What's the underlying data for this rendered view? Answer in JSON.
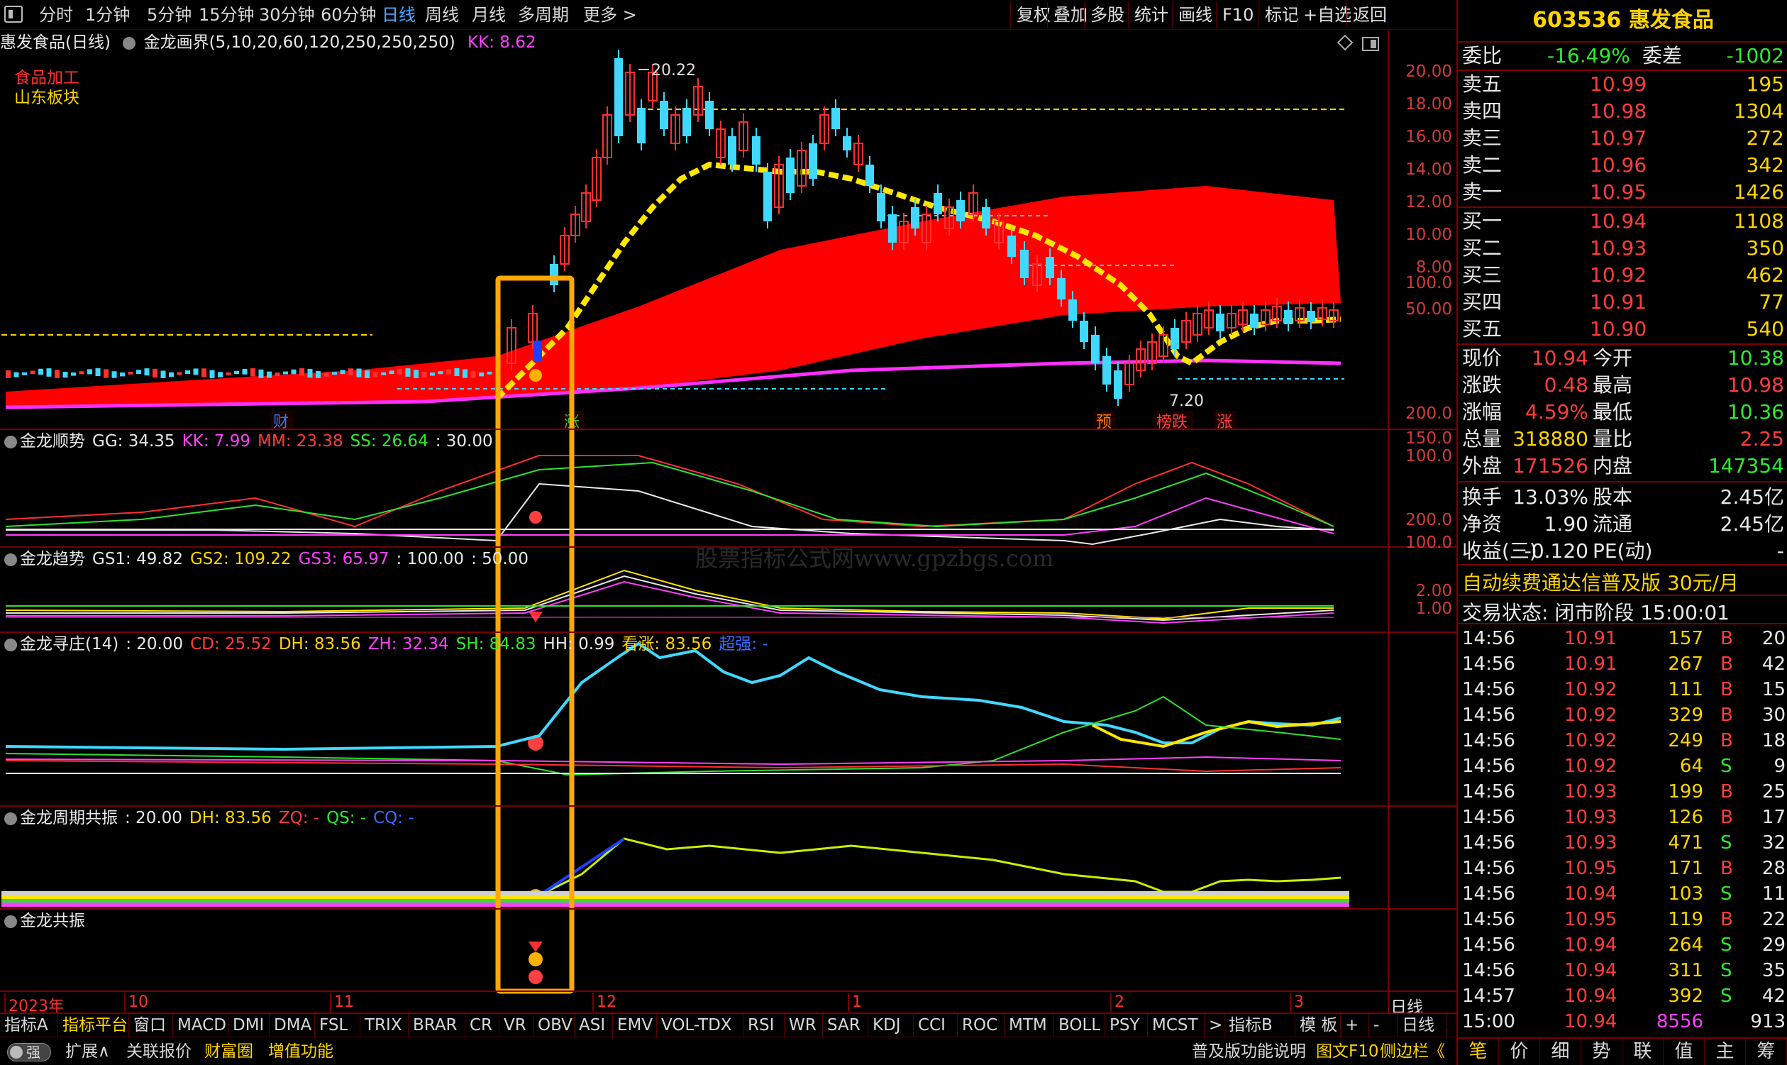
{
  "toolbar": {
    "items": [
      "分时",
      "1分钟",
      "5分钟",
      "15分钟",
      "30分钟",
      "60分钟",
      "日线",
      "周线",
      "月线",
      "多周期",
      "更多 >"
    ],
    "active_index": 6,
    "right_items": [
      "复权",
      "叠加",
      "多股",
      "统计",
      "画线",
      "F10",
      "标记",
      "+自选",
      "返回"
    ]
  },
  "chart_header": {
    "stock": "惠发食品(日线)",
    "indicator": "金龙画界(5,10,20,60,120,250,250,250)",
    "kk": "KK: 8.62",
    "tag1": "食品加工",
    "tag2": "山东板块"
  },
  "price_axis": [
    "20.00",
    "18.00",
    "16.00",
    "14.00",
    "12.00",
    "10.00",
    "8.00"
  ],
  "annotations": {
    "high": "20.22",
    "low": "7.20",
    "markers": [
      "财",
      "涨",
      "预",
      "榜跌",
      "涨"
    ]
  },
  "panels": [
    {
      "name": "金龙顺势",
      "values": [
        {
          "t": "GG: 34.35",
          "c": "white"
        },
        {
          "t": "KK: 7.99",
          "c": "magenta"
        },
        {
          "t": "MM: 23.38",
          "c": "red"
        },
        {
          "t": "SS: 26.64",
          "c": "green"
        },
        {
          "t": ": 30.00",
          "c": "white"
        }
      ],
      "axis": [
        "100.0",
        "50.00"
      ]
    },
    {
      "name": "金龙趋势",
      "values": [
        {
          "t": "GS1: 49.82",
          "c": "white"
        },
        {
          "t": "GS2: 109.22",
          "c": "yellow"
        },
        {
          "t": "GS3: 65.97",
          "c": "magenta"
        },
        {
          "t": ": 100.00",
          "c": "white"
        },
        {
          "t": ": 50.00",
          "c": "white"
        }
      ],
      "axis": []
    },
    {
      "name": "金龙寻庄(14)",
      "values": [
        {
          "t": ": 20.00",
          "c": "white"
        },
        {
          "t": "CD: 25.52",
          "c": "red"
        },
        {
          "t": "DH: 83.56",
          "c": "yellow"
        },
        {
          "t": "ZH: 32.34",
          "c": "magenta"
        },
        {
          "t": "SH: 84.83",
          "c": "green"
        },
        {
          "t": "HH: 0.99",
          "c": "white"
        },
        {
          "t": "看涨: 83.56",
          "c": "yellow"
        },
        {
          "t": "超强: -",
          "c": "blue"
        }
      ],
      "axis": [
        "200.0",
        "150.0",
        "100.0"
      ]
    },
    {
      "name": "金龙周期共振",
      "values": [
        {
          "t": ": 20.00",
          "c": "white"
        },
        {
          "t": "DH: 83.56",
          "c": "yellow"
        },
        {
          "t": "ZQ: -",
          "c": "red"
        },
        {
          "t": "QS: -",
          "c": "green"
        },
        {
          "t": "CQ: -",
          "c": "blue"
        }
      ],
      "axis": [
        "200.0",
        "100.0"
      ]
    },
    {
      "name": "金龙共振",
      "values": [],
      "axis": [
        "2.00",
        "1.00"
      ]
    }
  ],
  "x_axis": [
    "2023年",
    "10",
    "11",
    "12",
    "1",
    "2",
    "3"
  ],
  "x_axis_right": "日线",
  "watermark": "股票指标公式网www.gpzbgs.com",
  "bottom_tabs": [
    "指标A",
    "指标平台",
    "窗口",
    "MACD",
    "DMI",
    "DMA",
    "FSL",
    "TRIX",
    "BRAR",
    "CR",
    "VR",
    "OBV",
    "ASI",
    "EMV",
    "VOL-TDX",
    "RSI",
    "WR",
    "SAR",
    "KDJ",
    "CCI",
    "ROC",
    "MTM",
    "BOLL",
    "PSY",
    "MCST",
    ">",
    "指标B",
    "模 板",
    "+",
    "-",
    "日线"
  ],
  "status_bar": {
    "toggle": "强",
    "items": [
      "扩展∧",
      "关联报价",
      "财富圈",
      "增值功能"
    ],
    "right": [
      "普及版功能说明",
      "图文F10",
      "侧边栏《"
    ]
  },
  "quote": {
    "title": "603536 惠发食品",
    "weibi": {
      "label": "委比",
      "value": "-16.49%",
      "label2": "委差",
      "value2": "-1002"
    },
    "asks": [
      {
        "l": "卖五",
        "p": "10.99",
        "v": "195"
      },
      {
        "l": "卖四",
        "p": "10.98",
        "v": "1304"
      },
      {
        "l": "卖三",
        "p": "10.97",
        "v": "272"
      },
      {
        "l": "卖二",
        "p": "10.96",
        "v": "342"
      },
      {
        "l": "卖一",
        "p": "10.95",
        "v": "1426"
      }
    ],
    "bids": [
      {
        "l": "买一",
        "p": "10.94",
        "v": "1108"
      },
      {
        "l": "买二",
        "p": "10.93",
        "v": "350"
      },
      {
        "l": "买三",
        "p": "10.92",
        "v": "462"
      },
      {
        "l": "买四",
        "p": "10.91",
        "v": "77"
      },
      {
        "l": "买五",
        "p": "10.90",
        "v": "540"
      }
    ],
    "stats": [
      {
        "l1": "现价",
        "v1": "10.94",
        "c1": "red",
        "l2": "今开",
        "v2": "10.38",
        "c2": "green"
      },
      {
        "l1": "涨跌",
        "v1": "0.48",
        "c1": "red",
        "l2": "最高",
        "v2": "10.98",
        "c2": "red"
      },
      {
        "l1": "涨幅",
        "v1": "4.59%",
        "c1": "red",
        "l2": "最低",
        "v2": "10.36",
        "c2": "green"
      },
      {
        "l1": "总量",
        "v1": "318880",
        "c1": "yellow",
        "l2": "量比",
        "v2": "2.25",
        "c2": "red"
      },
      {
        "l1": "外盘",
        "v1": "171526",
        "c1": "red",
        "l2": "内盘",
        "v2": "147354",
        "c2": "green"
      },
      {
        "l1": "换手",
        "v1": "13.03%",
        "c1": "white",
        "l2": "股本",
        "v2": "2.45亿",
        "c2": "white"
      },
      {
        "l1": "净资",
        "v1": "1.90",
        "c1": "white",
        "l2": "流通",
        "v2": "2.45亿",
        "c2": "white"
      },
      {
        "l1": "收益(三)",
        "v1": "-0.120",
        "c1": "white",
        "l2": "PE(动)",
        "v2": "-",
        "c2": "white"
      }
    ],
    "promo": "自动续费通达信普及版  30元/月",
    "trade_state": "交易状态: 闭市阶段 15:00:01",
    "ticks": [
      {
        "t": "14:56",
        "p": "10.91",
        "v": "157",
        "s": "B",
        "n": "20"
      },
      {
        "t": "14:56",
        "p": "10.91",
        "v": "267",
        "s": "B",
        "n": "42"
      },
      {
        "t": "14:56",
        "p": "10.92",
        "v": "111",
        "s": "B",
        "n": "15"
      },
      {
        "t": "14:56",
        "p": "10.92",
        "v": "329",
        "s": "B",
        "n": "30"
      },
      {
        "t": "14:56",
        "p": "10.92",
        "v": "249",
        "s": "B",
        "n": "18"
      },
      {
        "t": "14:56",
        "p": "10.92",
        "v": "64",
        "s": "S",
        "n": "9"
      },
      {
        "t": "14:56",
        "p": "10.93",
        "v": "199",
        "s": "B",
        "n": "25"
      },
      {
        "t": "14:56",
        "p": "10.93",
        "v": "126",
        "s": "B",
        "n": "17"
      },
      {
        "t": "14:56",
        "p": "10.93",
        "v": "471",
        "s": "S",
        "n": "32"
      },
      {
        "t": "14:56",
        "p": "10.95",
        "v": "171",
        "s": "B",
        "n": "28"
      },
      {
        "t": "14:56",
        "p": "10.94",
        "v": "103",
        "s": "S",
        "n": "11"
      },
      {
        "t": "14:56",
        "p": "10.95",
        "v": "119",
        "s": "B",
        "n": "22"
      },
      {
        "t": "14:56",
        "p": "10.94",
        "v": "264",
        "s": "S",
        "n": "29"
      },
      {
        "t": "14:56",
        "p": "10.94",
        "v": "311",
        "s": "S",
        "n": "35"
      },
      {
        "t": "14:57",
        "p": "10.94",
        "v": "392",
        "s": "S",
        "n": "42"
      },
      {
        "t": "15:00",
        "p": "10.94",
        "v": "8556",
        "s": "",
        "n": "913"
      }
    ],
    "nav": [
      "笔",
      "价",
      "细",
      "势",
      "联",
      "值",
      "主",
      "筹"
    ],
    "nav_active": 0
  }
}
